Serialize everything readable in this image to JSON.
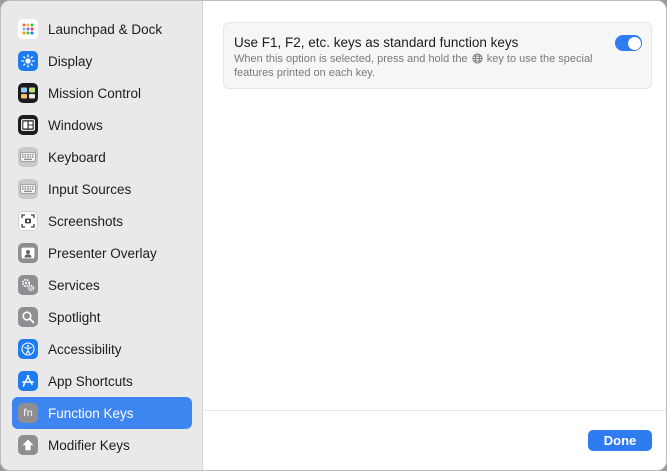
{
  "sidebar": {
    "items": [
      {
        "label": "Launchpad & Dock",
        "icon": "launchpad-icon"
      },
      {
        "label": "Display",
        "icon": "display-icon"
      },
      {
        "label": "Mission Control",
        "icon": "mission-control-icon"
      },
      {
        "label": "Windows",
        "icon": "windows-icon"
      },
      {
        "label": "Keyboard",
        "icon": "keyboard-icon"
      },
      {
        "label": "Input Sources",
        "icon": "input-sources-icon"
      },
      {
        "label": "Screenshots",
        "icon": "screenshots-icon"
      },
      {
        "label": "Presenter Overlay",
        "icon": "presenter-overlay-icon"
      },
      {
        "label": "Services",
        "icon": "services-icon"
      },
      {
        "label": "Spotlight",
        "icon": "spotlight-icon"
      },
      {
        "label": "Accessibility",
        "icon": "accessibility-icon"
      },
      {
        "label": "App Shortcuts",
        "icon": "app-shortcuts-icon"
      },
      {
        "label": "Function Keys",
        "icon": "function-keys-icon",
        "selected": true
      },
      {
        "label": "Modifier Keys",
        "icon": "modifier-keys-icon"
      }
    ]
  },
  "main": {
    "option": {
      "title": "Use F1, F2, etc. keys as standard function keys",
      "desc_before": "When this option is selected, press and hold the",
      "desc_after": "key to use the special features printed on each key.",
      "enabled": true
    },
    "done_label": "Done",
    "fn_glyph": "fn"
  },
  "colors": {
    "accent": "#3d85f0",
    "toggle_on": "#2f7bf0"
  }
}
